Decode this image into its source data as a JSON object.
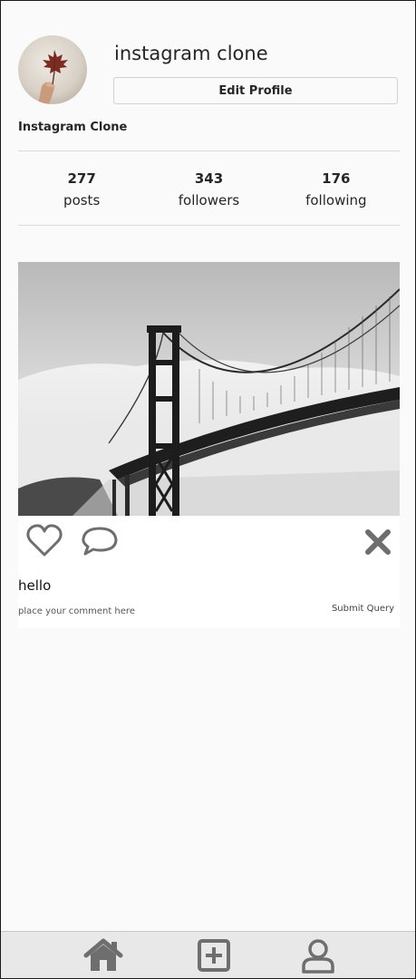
{
  "profile": {
    "username": "instagram clone",
    "edit_button_label": "Edit Profile",
    "display_name": "Instagram Clone",
    "avatar_icon": "maple-leaf-photo"
  },
  "stats": [
    {
      "count": "277",
      "label": "posts"
    },
    {
      "count": "343",
      "label": "followers"
    },
    {
      "count": "176",
      "label": "following"
    }
  ],
  "post": {
    "image_subject": "golden-gate-bridge-photo",
    "caption": "hello",
    "comment_placeholder": "place your comment here",
    "submit_label": "Submit Query",
    "icons": [
      "heart-icon",
      "comment-icon",
      "close-icon"
    ]
  },
  "bottom_nav": {
    "icons": [
      "home-icon",
      "add-post-icon",
      "profile-icon"
    ]
  },
  "colors": {
    "background": "#fafafa",
    "text": "#262626",
    "icon": "#6e6e6e",
    "nav_background": "#e8e8e8",
    "divider": "#dbdbdb"
  }
}
